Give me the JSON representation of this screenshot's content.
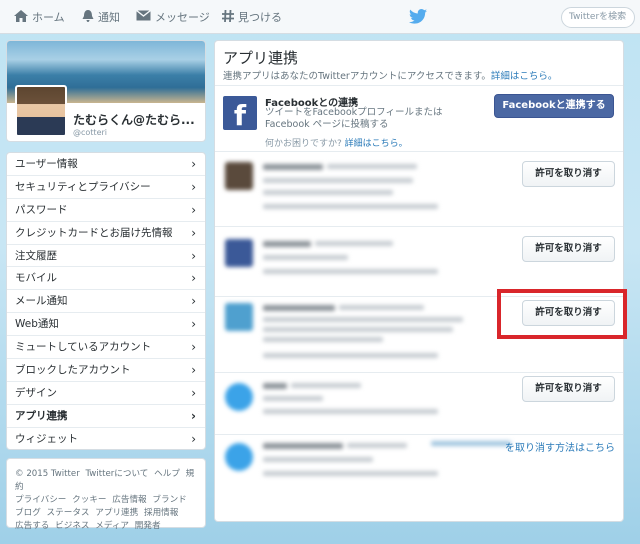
{
  "nav": {
    "home": "ホーム",
    "notifications": "通知",
    "messages": "メッセージ",
    "discover": "見つける",
    "search_placeholder": "Twitterを検索"
  },
  "profile": {
    "name": "たむらくん@たむら...",
    "handle": "@cotteri"
  },
  "menu": {
    "items": [
      "ユーザー情報",
      "セキュリティとプライバシー",
      "パスワード",
      "クレジットカードとお届け先情報",
      "注文履歴",
      "モバイル",
      "メール通知",
      "Web通知",
      "ミュートしているアカウント",
      "ブロックしたアカウント",
      "デザイン",
      "アプリ連携",
      "ウィジェット"
    ],
    "active_index": 11,
    "chevron": "›"
  },
  "footer": {
    "links": [
      "© 2015 Twitter",
      "Twitterについて",
      "ヘルプ",
      "規約",
      "プライバシー",
      "クッキー",
      "広告情報",
      "ブランド",
      "ブログ",
      "ステータス",
      "アプリ連携",
      "採用情報",
      "広告する",
      "ビジネス",
      "メディア",
      "開発者"
    ]
  },
  "main": {
    "title": "アプリ連携",
    "description": "連携アプリはあなたのTwitterアカウントにアクセスできます。",
    "details_link": "詳細はこちら。",
    "facebook": {
      "title": "Facebookとの連携",
      "description": "ツイートをFacebookプロフィールまたはFacebook ページに投稿する",
      "help_text": "何かお困りですか?",
      "help_link": "詳細はこちら。",
      "connect_button": "Facebookと連携する"
    },
    "revoke_label": "許可を取り消す",
    "revoke_how": "を取り消す方法はこちら"
  },
  "colors": {
    "accent_link": "#2b7bb9",
    "facebook_blue": "#4b68a3",
    "highlight_red": "#d9262b",
    "twitter_blue": "#55acee"
  },
  "icons": {
    "home": "home-icon",
    "notifications": "bell-icon",
    "messages": "envelope-icon",
    "discover": "hash-icon",
    "logo": "twitter-bird-icon"
  }
}
